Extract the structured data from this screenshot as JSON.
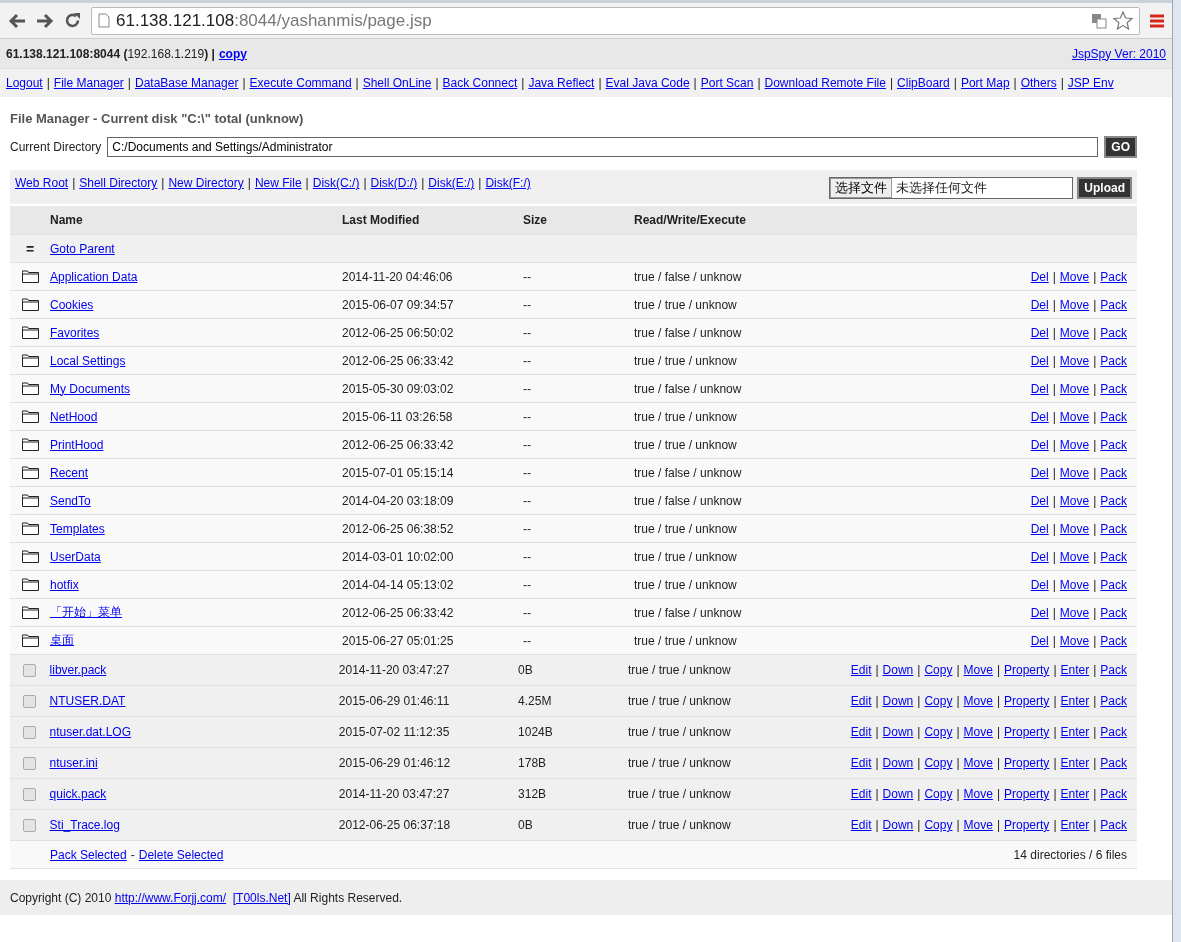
{
  "browser": {
    "url_host": "61.138.121.108",
    "url_path": ":8044/yashanmis/page.jsp"
  },
  "info_bar": {
    "host": "**61.138.121.108:8044 (**192.168.1.219**) |**",
    "copy_link": "copy",
    "version_link": "JspSpy Ver: 2010"
  },
  "link_separator": "|",
  "nav_links": [
    "Logout",
    "File Manager",
    "DataBase Manager",
    "Execute Command",
    "Shell OnLine",
    "Back Connect",
    "Java Reflect",
    "Eval Java Code",
    "Port Scan",
    "Download Remote File",
    "ClipBoard",
    "Port Map",
    "Others",
    "JSP Env"
  ],
  "title": "File Manager - Current disk \"C:\\\" total (unknow)",
  "directory": {
    "label": "Current Directory",
    "value": "C:/Documents and Settings/Administrator",
    "go_button": "GO"
  },
  "quick_links": [
    "Web Root",
    "Shell Directory",
    "New Directory",
    "New File",
    "Disk(C:/)",
    "Disk(D:/)",
    "Disk(E:/)",
    "Disk(F:/)"
  ],
  "upload": {
    "choose_button": "选择文件",
    "status": "未选择任何文件",
    "upload_button": "Upload"
  },
  "table": {
    "columns": [
      "Name",
      "Last Modified",
      "Size",
      "Read/Write/Execute"
    ],
    "parent_row": {
      "icon": "=",
      "link": "Goto Parent"
    },
    "rows": [
      {
        "kind": "folder",
        "name": "Application Data",
        "modified": "2014-11-20 04:46:06",
        "size": "--",
        "rwx": "true / false / unknow",
        "actions": [
          "Del",
          "Move",
          "Pack"
        ]
      },
      {
        "kind": "folder",
        "name": "Cookies",
        "modified": "2015-06-07 09:34:57",
        "size": "--",
        "rwx": "true / true / unknow",
        "actions": [
          "Del",
          "Move",
          "Pack"
        ]
      },
      {
        "kind": "folder",
        "name": "Favorites",
        "modified": "2012-06-25 06:50:02",
        "size": "--",
        "rwx": "true / false / unknow",
        "actions": [
          "Del",
          "Move",
          "Pack"
        ]
      },
      {
        "kind": "folder",
        "name": "Local Settings",
        "modified": "2012-06-25 06:33:42",
        "size": "--",
        "rwx": "true / true / unknow",
        "actions": [
          "Del",
          "Move",
          "Pack"
        ]
      },
      {
        "kind": "folder",
        "name": "My Documents",
        "modified": "2015-05-30 09:03:02",
        "size": "--",
        "rwx": "true / false / unknow",
        "actions": [
          "Del",
          "Move",
          "Pack"
        ]
      },
      {
        "kind": "folder",
        "name": "NetHood",
        "modified": "2015-06-11 03:26:58",
        "size": "--",
        "rwx": "true / true / unknow",
        "actions": [
          "Del",
          "Move",
          "Pack"
        ]
      },
      {
        "kind": "folder",
        "name": "PrintHood",
        "modified": "2012-06-25 06:33:42",
        "size": "--",
        "rwx": "true / true / unknow",
        "actions": [
          "Del",
          "Move",
          "Pack"
        ]
      },
      {
        "kind": "folder",
        "name": "Recent",
        "modified": "2015-07-01 05:15:14",
        "size": "--",
        "rwx": "true / false / unknow",
        "actions": [
          "Del",
          "Move",
          "Pack"
        ]
      },
      {
        "kind": "folder",
        "name": "SendTo",
        "modified": "2014-04-20 03:18:09",
        "size": "--",
        "rwx": "true / false / unknow",
        "actions": [
          "Del",
          "Move",
          "Pack"
        ]
      },
      {
        "kind": "folder",
        "name": "Templates",
        "modified": "2012-06-25 06:38:52",
        "size": "--",
        "rwx": "true / true / unknow",
        "actions": [
          "Del",
          "Move",
          "Pack"
        ]
      },
      {
        "kind": "folder",
        "name": "UserData",
        "modified": "2014-03-01 10:02:00",
        "size": "--",
        "rwx": "true / true / unknow",
        "actions": [
          "Del",
          "Move",
          "Pack"
        ]
      },
      {
        "kind": "folder",
        "name": "hotfix",
        "modified": "2014-04-14 05:13:02",
        "size": "--",
        "rwx": "true / true / unknow",
        "actions": [
          "Del",
          "Move",
          "Pack"
        ]
      },
      {
        "kind": "folder",
        "name": "「开始」菜单",
        "modified": "2012-06-25 06:33:42",
        "size": "--",
        "rwx": "true / false / unknow",
        "actions": [
          "Del",
          "Move",
          "Pack"
        ]
      },
      {
        "kind": "folder",
        "name": "桌面",
        "modified": "2015-06-27 05:01:25",
        "size": "--",
        "rwx": "true / true / unknow",
        "actions": [
          "Del",
          "Move",
          "Pack"
        ]
      },
      {
        "kind": "file",
        "checked": false,
        "name": "libver.pack",
        "modified": "2014-11-20 03:47:27",
        "size": "0B",
        "rwx": "true / true / unknow",
        "actions": [
          "Edit",
          "Down",
          "Copy",
          "Move",
          "Property",
          "Enter",
          "Pack"
        ]
      },
      {
        "kind": "file",
        "checked": false,
        "name": "NTUSER.DAT",
        "modified": "2015-06-29 01:46:11",
        "size": "4.25M",
        "rwx": "true / true / unknow",
        "actions": [
          "Edit",
          "Down",
          "Copy",
          "Move",
          "Property",
          "Enter",
          "Pack"
        ]
      },
      {
        "kind": "file",
        "checked": false,
        "name": "ntuser.dat.LOG",
        "modified": "2015-07-02 11:12:35",
        "size": "1024B",
        "rwx": "true / true / unknow",
        "actions": [
          "Edit",
          "Down",
          "Copy",
          "Move",
          "Property",
          "Enter",
          "Pack"
        ]
      },
      {
        "kind": "file",
        "checked": false,
        "name": "ntuser.ini",
        "modified": "2015-06-29 01:46:12",
        "size": "178B",
        "rwx": "true / true / unknow",
        "actions": [
          "Edit",
          "Down",
          "Copy",
          "Move",
          "Property",
          "Enter",
          "Pack"
        ]
      },
      {
        "kind": "file",
        "checked": false,
        "name": "quick.pack",
        "modified": "2014-11-20 03:47:27",
        "size": "312B",
        "rwx": "true / true / unknow",
        "actions": [
          "Edit",
          "Down",
          "Copy",
          "Move",
          "Property",
          "Enter",
          "Pack"
        ]
      },
      {
        "kind": "file",
        "checked": false,
        "name": "Sti_Trace.log",
        "modified": "2012-06-25 06:37:18",
        "size": "0B",
        "rwx": "true / true / unknow",
        "actions": [
          "Edit",
          "Down",
          "Copy",
          "Move",
          "Property",
          "Enter",
          "Pack"
        ]
      }
    ],
    "footer": {
      "links": [
        "Pack Selected",
        "Delete Selected"
      ],
      "separator": "-",
      "summary": "14 directories / 6 files"
    }
  },
  "copyright": {
    "prefix": "Copyright (C) 2010",
    "links": [
      "http://www.Forjj.com/",
      "[T00ls.Net]"
    ],
    "suffix": "All Rights Reserved."
  }
}
